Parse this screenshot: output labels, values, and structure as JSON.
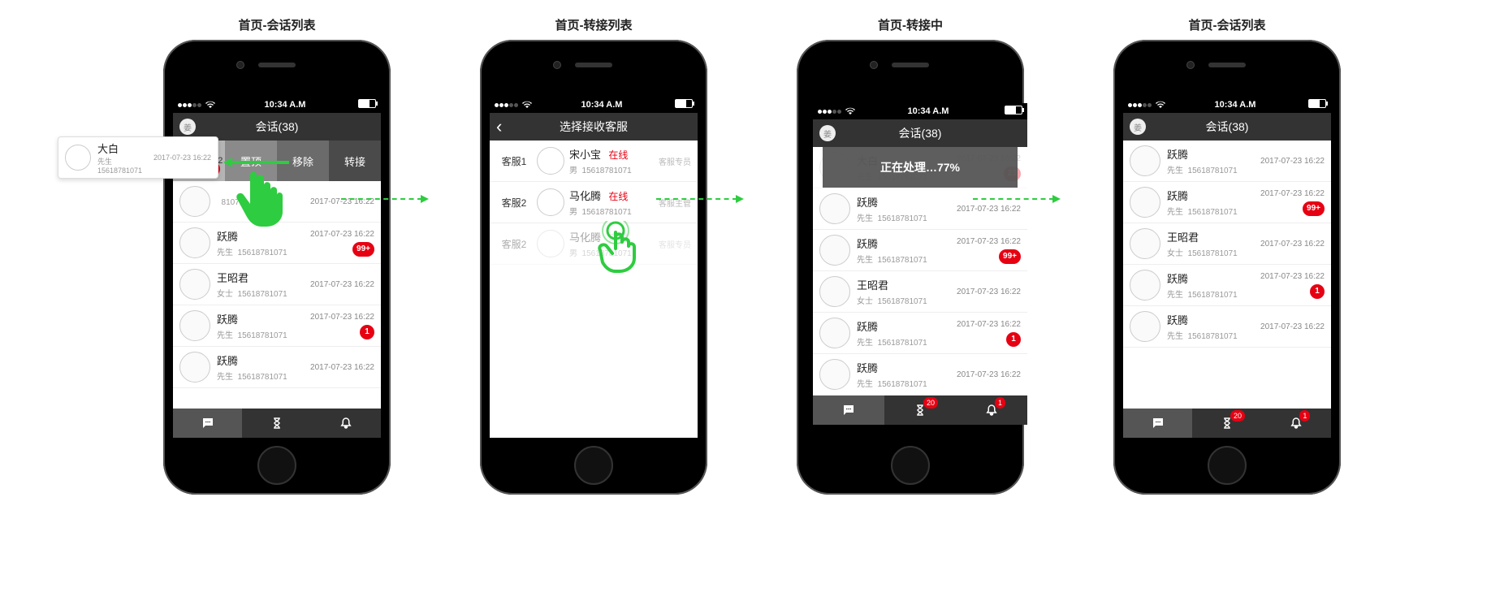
{
  "status_time": "10:34 A.M",
  "captions": [
    "首页-会话列表",
    "首页-转接列表",
    "首页-转接中",
    "首页-会话列表"
  ],
  "nav": {
    "conversation_title": "会话(38)",
    "select_agent_title": "选择接收客服",
    "avatar_char": "姜"
  },
  "swipe": {
    "time_fragment": "07-23 16:22",
    "pin": "置顶",
    "remove": "移除",
    "transfer": "转接",
    "badge": "23"
  },
  "popover": {
    "name": "大白",
    "honor": "先生",
    "phone": "15618781071",
    "time": "2017-07-23 16:22"
  },
  "toast": "正在处理…77%",
  "tabbadges": {
    "pending": "20",
    "notify": "1"
  },
  "agents": [
    {
      "group": "客服1",
      "name": "宋小宝",
      "status": "在线",
      "online": true,
      "gender": "男",
      "phone": "15618781071",
      "role": "客服专员"
    },
    {
      "group": "客服2",
      "name": "马化腾",
      "status": "在线",
      "online": true,
      "gender": "男",
      "phone": "15618781071",
      "role": "客服主管"
    },
    {
      "group": "客服2",
      "name": "马化腾",
      "status": "离线",
      "online": false,
      "gender": "男",
      "phone": "15618781071",
      "role": "客服专员"
    }
  ],
  "phone1_rows": [
    {
      "name": "",
      "honor": "",
      "phone": "81071",
      "time": "2017-07-23 16:22",
      "badge": ""
    },
    {
      "name": "跃腾",
      "honor": "先生",
      "phone": "15618781071",
      "time": "2017-07-23 16:22",
      "badge": "99+"
    },
    {
      "name": "王昭君",
      "honor": "女士",
      "phone": "15618781071",
      "time": "2017-07-23 16:22",
      "badge": ""
    },
    {
      "name": "跃腾",
      "honor": "先生",
      "phone": "15618781071",
      "time": "2017-07-23 16:22",
      "badge": "1"
    },
    {
      "name": "跃腾",
      "honor": "先生",
      "phone": "15618781071",
      "time": "2017-07-23 16:22",
      "badge": ""
    }
  ],
  "phone3_rows": [
    {
      "name": "大白",
      "honor": "先生",
      "phone": "15618781071",
      "time": "2017-07-23 16:22",
      "badge": "23",
      "dim": true
    },
    {
      "name": "跃腾",
      "honor": "先生",
      "phone": "15618781071",
      "time": "2017-07-23 16:22",
      "badge": ""
    },
    {
      "name": "跃腾",
      "honor": "先生",
      "phone": "15618781071",
      "time": "2017-07-23 16:22",
      "badge": "99+"
    },
    {
      "name": "王昭君",
      "honor": "女士",
      "phone": "15618781071",
      "time": "2017-07-23 16:22",
      "badge": ""
    },
    {
      "name": "跃腾",
      "honor": "先生",
      "phone": "15618781071",
      "time": "2017-07-23 16:22",
      "badge": "1"
    },
    {
      "name": "跃腾",
      "honor": "先生",
      "phone": "15618781071",
      "time": "2017-07-23 16:22",
      "badge": ""
    }
  ],
  "phone4_rows": [
    {
      "name": "跃腾",
      "honor": "先生",
      "phone": "15618781071",
      "time": "2017-07-23 16:22",
      "badge": ""
    },
    {
      "name": "跃腾",
      "honor": "先生",
      "phone": "15618781071",
      "time": "2017-07-23 16:22",
      "badge": "99+"
    },
    {
      "name": "王昭君",
      "honor": "女士",
      "phone": "15618781071",
      "time": "2017-07-23 16:22",
      "badge": ""
    },
    {
      "name": "跃腾",
      "honor": "先生",
      "phone": "15618781071",
      "time": "2017-07-23 16:22",
      "badge": "1"
    },
    {
      "name": "跃腾",
      "honor": "先生",
      "phone": "15618781071",
      "time": "2017-07-23 16:22",
      "badge": ""
    }
  ]
}
